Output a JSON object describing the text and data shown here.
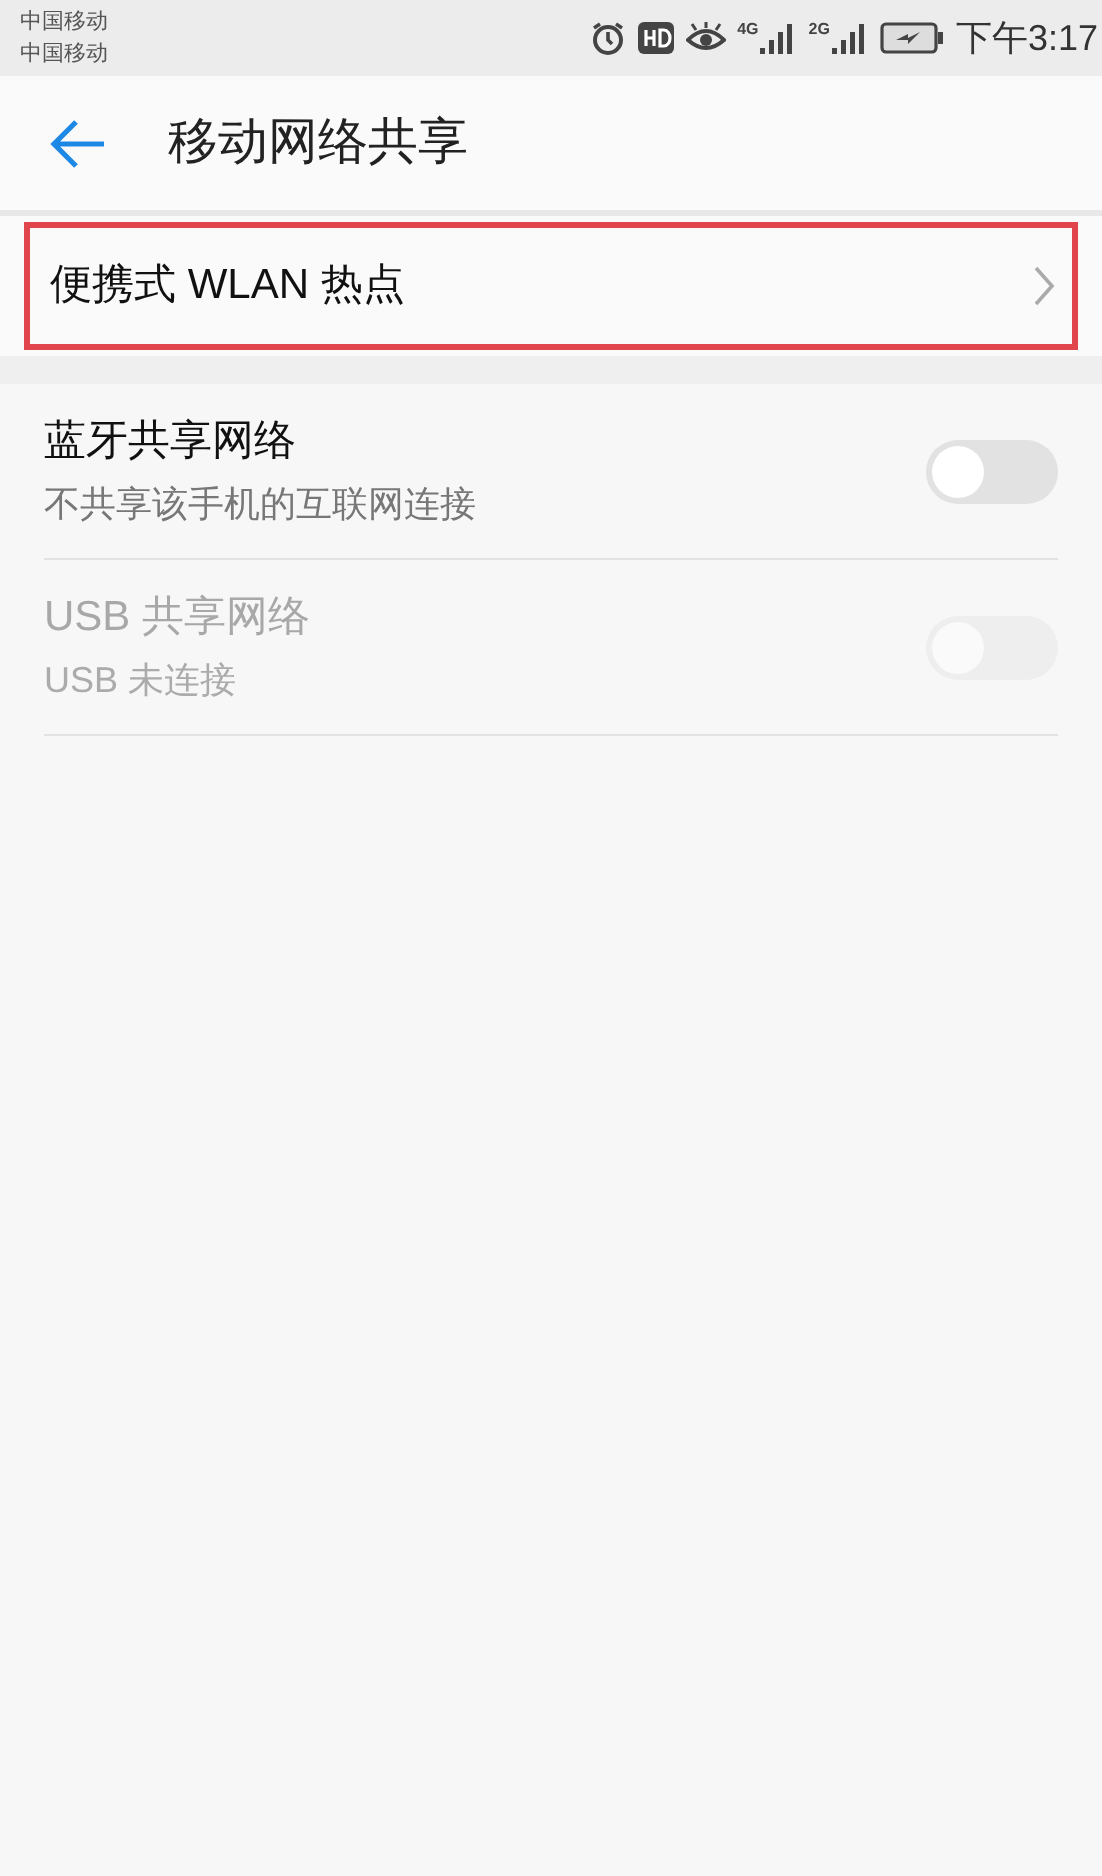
{
  "status_bar": {
    "carriers": [
      "中国移动",
      "中国移动"
    ],
    "networks": [
      "4G",
      "2G"
    ],
    "time": "下午3:17"
  },
  "header": {
    "title": "移动网络共享"
  },
  "link_item": {
    "label": "便携式 WLAN 热点",
    "highlighted": true
  },
  "toggles": [
    {
      "title": "蓝牙共享网络",
      "subtitle": "不共享该手机的互联网连接",
      "on": false,
      "disabled": false
    },
    {
      "title": "USB 共享网络",
      "subtitle": "USB 未连接",
      "on": false,
      "disabled": true
    }
  ]
}
